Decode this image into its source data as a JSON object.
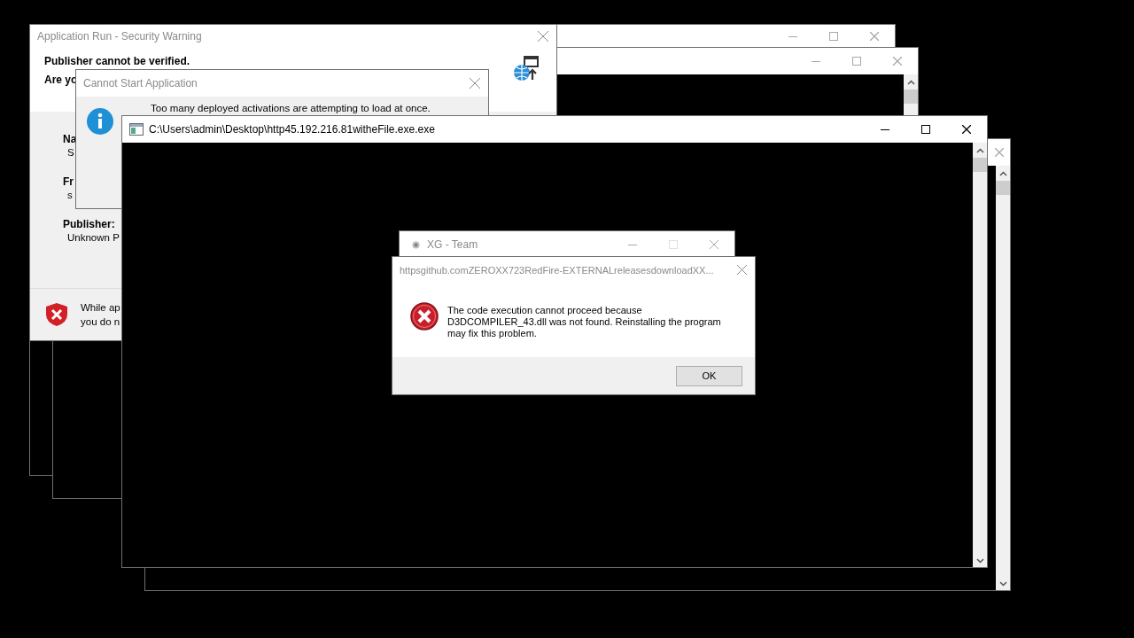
{
  "windows": [
    {
      "kind": "console",
      "active": false
    },
    {
      "kind": "console",
      "active": false
    },
    {
      "kind": "security_warning",
      "active": false,
      "title": "Application Run - Security Warning",
      "heading": "Publisher cannot be verified.",
      "question": "Are yo",
      "fields": [
        {
          "label": "Na",
          "value": "S"
        },
        {
          "label": "Fr",
          "value": "s"
        },
        {
          "label": "Publisher:",
          "value": "Unknown P"
        }
      ],
      "warning_lines": [
        "While ap",
        "you do n"
      ]
    },
    {
      "kind": "info_dialog",
      "active": false,
      "title": "Cannot Start Application",
      "message": "Too many deployed activations are attempting to load at once."
    },
    {
      "kind": "console"
    },
    {
      "kind": "console",
      "active": true,
      "title": "C:\\Users\\admin\\Desktop\\http45.192.216.81witheFile.exe.exe"
    },
    {
      "kind": "app_window",
      "active": false,
      "title": "XG - Team"
    },
    {
      "kind": "error_dialog",
      "active": false,
      "title": "httpsgithub.comZEROXX723RedFire-EXTERNALreleasesdownloadXX...",
      "message": "The code execution cannot proceed because D3DCOMPILER_43.dll was not found. Reinstalling the program may fix this problem.",
      "button": "OK"
    }
  ]
}
